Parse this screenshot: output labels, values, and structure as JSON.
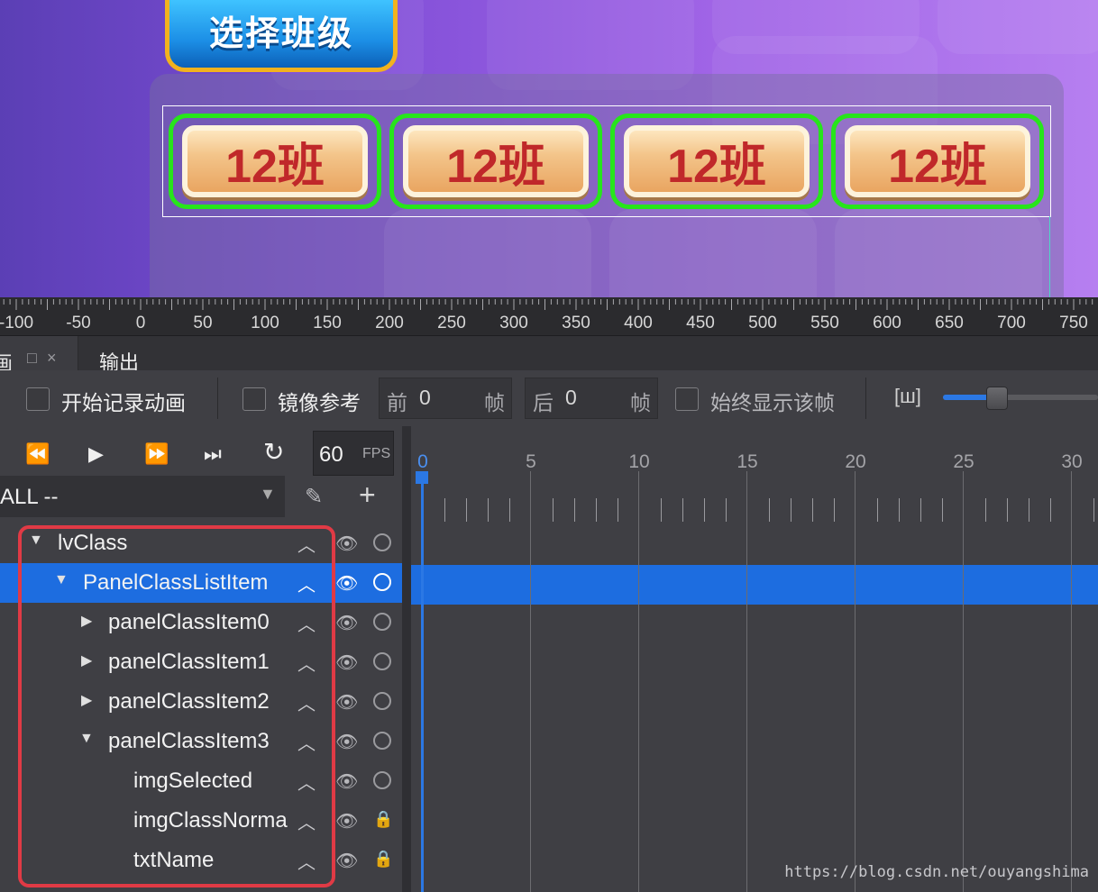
{
  "preview": {
    "title_button": "选择班级",
    "class_items": [
      "12班",
      "12班",
      "12班",
      "12班"
    ],
    "colors": {
      "item_border": "#27e51b",
      "item_text": "#c0282a",
      "selection": "#ffffff"
    }
  },
  "ruler": {
    "labels": [
      "-100",
      "-50",
      "0",
      "50",
      "100",
      "150",
      "200",
      "250",
      "300",
      "350",
      "400",
      "450",
      "500",
      "550",
      "600",
      "650",
      "700",
      "750"
    ]
  },
  "tabs": {
    "animation_label": "画",
    "restore_icon": "□",
    "close_icon": "×",
    "output": "输出"
  },
  "toolbar": {
    "record_label": "开始记录动画",
    "mirror_label": "镜像参考",
    "prev_label": "前",
    "prev_value": "0",
    "prev_unit": "帧",
    "next_label": "后",
    "next_value": "0",
    "next_unit": "帧",
    "always_show_label": "始终显示该帧",
    "zoom_icon": "[ш]",
    "zoom_level": 0.35
  },
  "playback": {
    "rewind_icon": "⏪",
    "play_icon": "▶",
    "fast_forward_icon": "⏩",
    "skip_end_icon": "⏭",
    "loop_icon": "↻",
    "fps_value": "60",
    "fps_unit": "FPS"
  },
  "layer_select": {
    "value": "ALL --",
    "dropdown_icon": "▼",
    "edit_icon": "✎",
    "add_icon": "+"
  },
  "tree": {
    "up_icon": "︿",
    "eye_icon": "👁",
    "lock_icon": "🔒",
    "items": [
      {
        "name": "lvClass",
        "expander": "▼"
      },
      {
        "name": "PanelClassListItem",
        "expander": "▼"
      },
      {
        "name": "panelClassItem0",
        "expander": "▶"
      },
      {
        "name": "panelClassItem1",
        "expander": "▶"
      },
      {
        "name": "panelClassItem2",
        "expander": "▶"
      },
      {
        "name": "panelClassItem3",
        "expander": "▼"
      },
      {
        "name": "imgSelected",
        "expander": ""
      },
      {
        "name": "imgClassNorma",
        "expander": ""
      },
      {
        "name": "txtName",
        "expander": ""
      }
    ]
  },
  "timeline": {
    "frame_labels": [
      "0",
      "5",
      "10",
      "15",
      "20",
      "25",
      "30"
    ],
    "current_frame": "0"
  },
  "watermark": "https://blog.csdn.net/ouyangshima"
}
